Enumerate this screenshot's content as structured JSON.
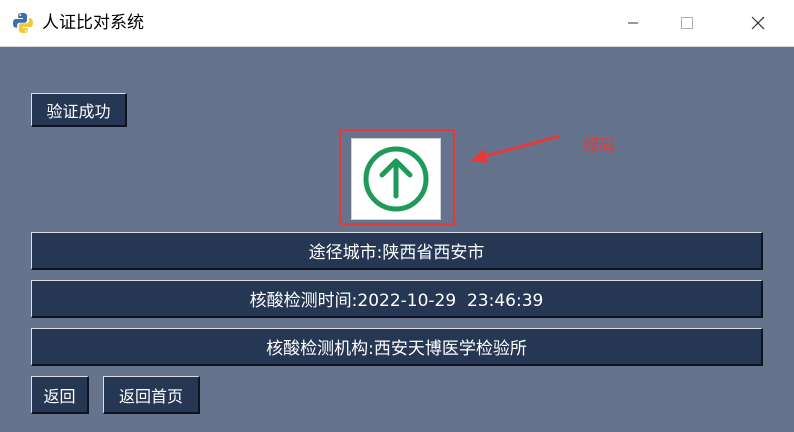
{
  "window": {
    "title": "人证比对系统",
    "icon": "python-logo-icon"
  },
  "status_button": {
    "label": "验证成功"
  },
  "health_code": {
    "icon": "green-arrow-up-icon",
    "color": "#1e9b59",
    "annotation": "绿码",
    "annotation_color": "#e53a3a"
  },
  "info": {
    "route": "途径城市:陕西省西安市",
    "test_time": "核酸检测时间:2022-10-29  23:46:39",
    "test_org": "核酸检测机构:西安天博医学检验所"
  },
  "buttons": {
    "back": "返回",
    "home": "返回首页"
  },
  "colors": {
    "background": "#65748c",
    "button": "#263754"
  }
}
